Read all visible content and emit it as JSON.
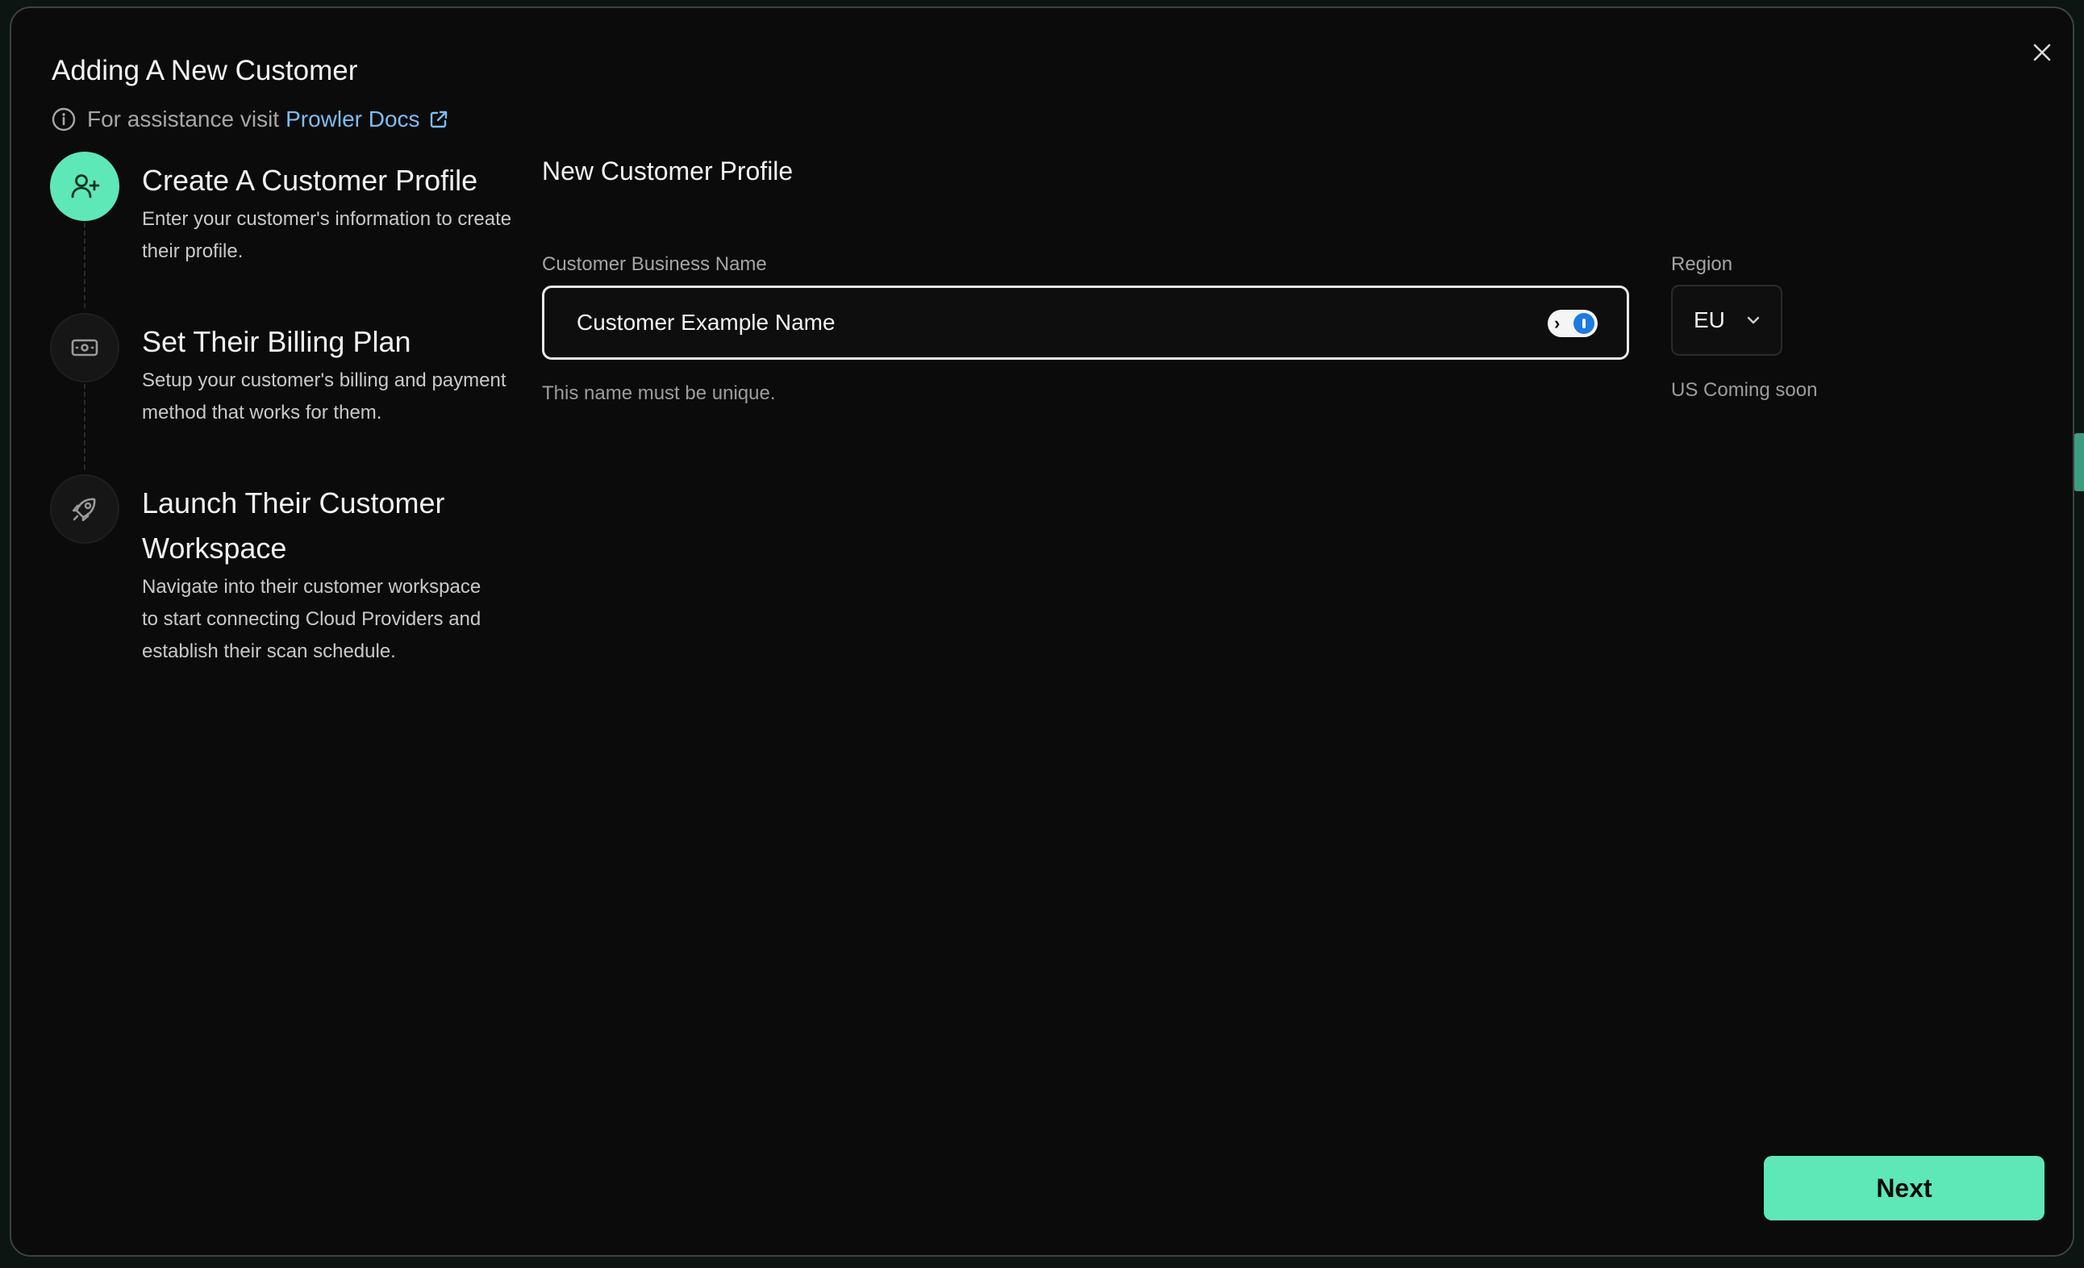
{
  "modal": {
    "title": "Adding A New Customer",
    "assist_text": "For assistance visit",
    "docs_link": "Prowler Docs",
    "close_icon": "close-icon"
  },
  "steps": [
    {
      "title": "Create A Customer Profile",
      "desc": "Enter your customer's information to create their profile.",
      "icon": "user-plus-icon",
      "active": true
    },
    {
      "title": "Set Their Billing Plan",
      "desc": "Setup your customer's billing and payment method that works for them.",
      "icon": "banknote-icon",
      "active": false
    },
    {
      "title": "Launch Their Customer Workspace",
      "desc": "Navigate into their customer workspace to start connecting Cloud Providers and establish their scan schedule.",
      "icon": "rocket-icon",
      "active": false
    }
  ],
  "form": {
    "heading": "New Customer Profile",
    "name_label": "Customer Business Name",
    "name_value": "Customer Example Name",
    "name_hint": "This name must be unique.",
    "region_label": "Region",
    "region_value": "EU",
    "region_hint": "US Coming soon"
  },
  "next_label": "Next",
  "colors": {
    "accent": "#5EE8B7",
    "link": "#7DBDF2",
    "background": "#0B0B0B"
  }
}
